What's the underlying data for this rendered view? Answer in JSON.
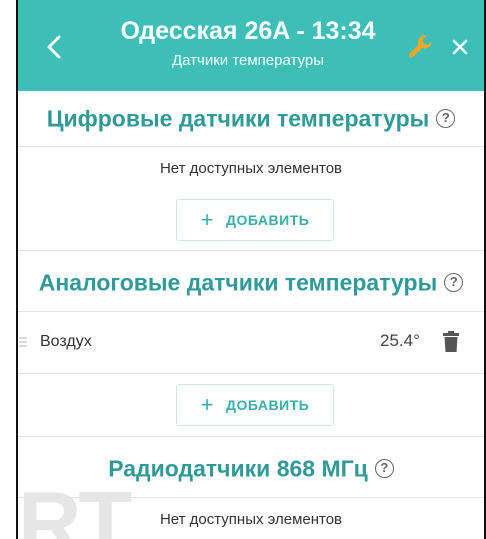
{
  "header": {
    "title": "Одесская 26A - 13:34",
    "subtitle": "Датчики температуры",
    "back_icon": "chevron-left-icon",
    "settings_icon": "wrench-icon",
    "close_icon": "close-icon"
  },
  "sections": [
    {
      "title": "Цифровые датчики температуры",
      "help": "?",
      "empty_text": "Нет доступных элементов",
      "add_label": "ДОБАВИТЬ",
      "add_plus": "+"
    },
    {
      "title": "Аналоговые датчики температуры",
      "help": "?",
      "items": [
        {
          "name": "Воздух",
          "value": "25.4°"
        }
      ],
      "add_label": "ДОБАВИТЬ",
      "add_plus": "+"
    },
    {
      "title": "Радиодатчики 868 МГц",
      "help": "?",
      "empty_text": "Нет доступных элементов"
    }
  ],
  "watermark": "RT",
  "colors": {
    "header_bg": "#3dbfb8",
    "section_title": "#2f9a97",
    "wrench": "#f5a623",
    "add_button_text": "#3aaea9"
  }
}
